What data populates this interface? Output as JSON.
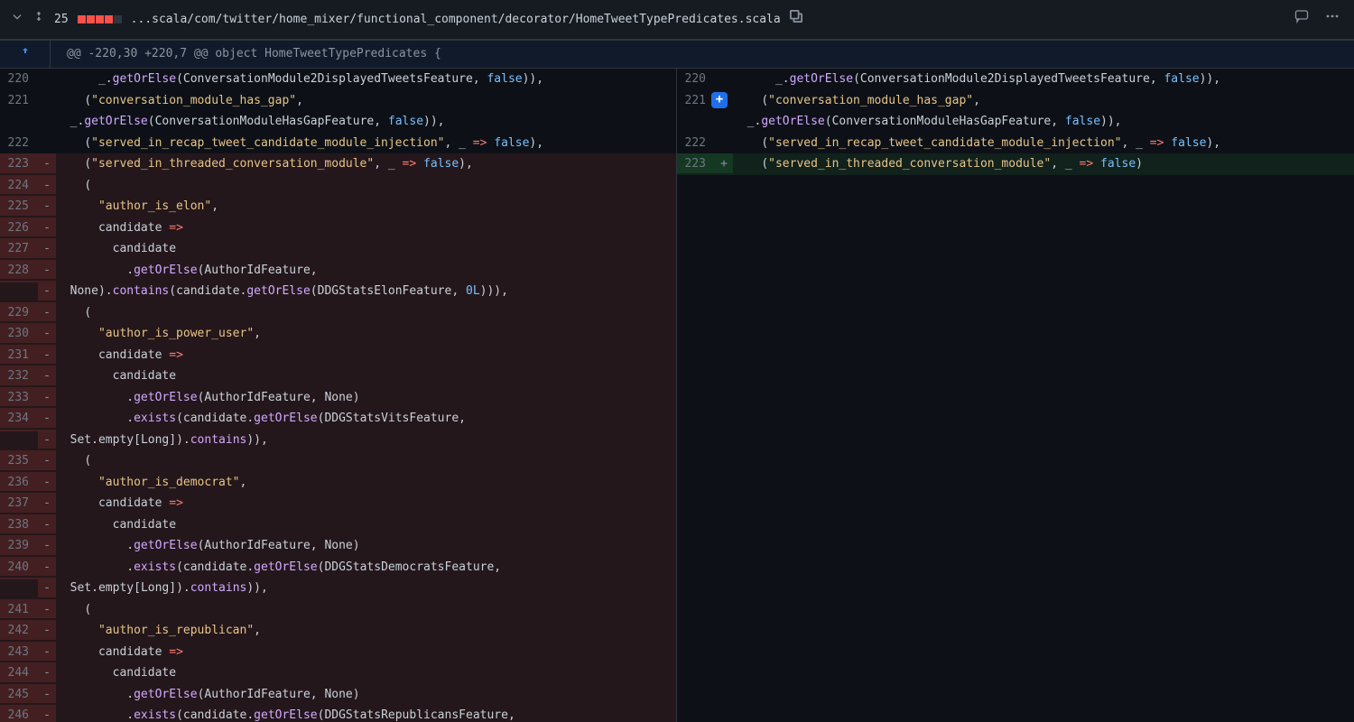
{
  "header": {
    "change_count": "25",
    "filepath": "...scala/com/twitter/home_mixer/functional_component/decorator/HomeTweetTypePredicates.scala",
    "diffstat_del": 4,
    "diffstat_neutral": 1
  },
  "hunk": {
    "text": "@@ -220,30 +220,7 @@ object HomeTweetTypePredicates {"
  },
  "left_lines": [
    {
      "n": "220",
      "t": "ctx",
      "tokens": [
        [
          "pl",
          "      _."
        ],
        [
          "fn",
          "getOrElse"
        ],
        [
          "pl",
          "("
        ],
        [
          "id",
          "ConversationModule2DisplayedTweetsFeature"
        ],
        [
          "pl",
          ", "
        ],
        [
          "false",
          "false"
        ],
        [
          "pl",
          ")),"
        ]
      ]
    },
    {
      "n": "221",
      "t": "ctx",
      "tokens": [
        [
          "pl",
          "    ("
        ],
        [
          "str",
          "\"conversation_module_has_gap\""
        ],
        [
          "pl",
          ","
        ]
      ]
    },
    {
      "n": "",
      "t": "ctx",
      "tokens": [
        [
          "pl",
          "  _."
        ],
        [
          "fn",
          "getOrElse"
        ],
        [
          "pl",
          "("
        ],
        [
          "id",
          "ConversationModuleHasGapFeature"
        ],
        [
          "pl",
          ", "
        ],
        [
          "false",
          "false"
        ],
        [
          "pl",
          ")),"
        ]
      ]
    },
    {
      "n": "222",
      "t": "ctx",
      "tokens": [
        [
          "pl",
          "    ("
        ],
        [
          "str",
          "\"served_in_recap_tweet_candidate_module_injection\""
        ],
        [
          "pl",
          ", _ "
        ],
        [
          "op",
          "=>"
        ],
        [
          "pl",
          " "
        ],
        [
          "false",
          "false"
        ],
        [
          "pl",
          "),"
        ]
      ]
    },
    {
      "n": "223",
      "t": "del",
      "tokens": [
        [
          "pl",
          "    ("
        ],
        [
          "str",
          "\"served_in_threaded_conversation_module\""
        ],
        [
          "pl",
          ", _ "
        ],
        [
          "op",
          "=>"
        ],
        [
          "pl",
          " "
        ],
        [
          "false",
          "false"
        ],
        [
          "pl",
          "),"
        ]
      ]
    },
    {
      "n": "224",
      "t": "del",
      "tokens": [
        [
          "pl",
          "    ("
        ]
      ]
    },
    {
      "n": "225",
      "t": "del",
      "tokens": [
        [
          "pl",
          "      "
        ],
        [
          "str",
          "\"author_is_elon\""
        ],
        [
          "pl",
          ","
        ]
      ]
    },
    {
      "n": "226",
      "t": "del",
      "tokens": [
        [
          "pl",
          "      candidate "
        ],
        [
          "op",
          "=>"
        ]
      ]
    },
    {
      "n": "227",
      "t": "del",
      "tokens": [
        [
          "pl",
          "        candidate"
        ]
      ]
    },
    {
      "n": "228",
      "t": "del",
      "tokens": [
        [
          "pl",
          "          ."
        ],
        [
          "fn",
          "getOrElse"
        ],
        [
          "pl",
          "("
        ],
        [
          "id",
          "AuthorIdFeature"
        ],
        [
          "pl",
          ","
        ]
      ]
    },
    {
      "n": "",
      "t": "del",
      "tokens": [
        [
          "pl",
          "  "
        ],
        [
          "id",
          "None"
        ],
        [
          "pl",
          ")."
        ],
        [
          "fn",
          "contains"
        ],
        [
          "pl",
          "(candidate."
        ],
        [
          "fn",
          "getOrElse"
        ],
        [
          "pl",
          "("
        ],
        [
          "id",
          "DDGStatsElonFeature"
        ],
        [
          "pl",
          ", "
        ],
        [
          "num",
          "0L"
        ],
        [
          "pl",
          "))),"
        ]
      ]
    },
    {
      "n": "229",
      "t": "del",
      "tokens": [
        [
          "pl",
          "    ("
        ]
      ]
    },
    {
      "n": "230",
      "t": "del",
      "tokens": [
        [
          "pl",
          "      "
        ],
        [
          "str",
          "\"author_is_power_user\""
        ],
        [
          "pl",
          ","
        ]
      ]
    },
    {
      "n": "231",
      "t": "del",
      "tokens": [
        [
          "pl",
          "      candidate "
        ],
        [
          "op",
          "=>"
        ]
      ]
    },
    {
      "n": "232",
      "t": "del",
      "tokens": [
        [
          "pl",
          "        candidate"
        ]
      ]
    },
    {
      "n": "233",
      "t": "del",
      "tokens": [
        [
          "pl",
          "          ."
        ],
        [
          "fn",
          "getOrElse"
        ],
        [
          "pl",
          "("
        ],
        [
          "id",
          "AuthorIdFeature"
        ],
        [
          "pl",
          ", "
        ],
        [
          "id",
          "None"
        ],
        [
          "pl",
          ")"
        ]
      ]
    },
    {
      "n": "234",
      "t": "del",
      "tokens": [
        [
          "pl",
          "          ."
        ],
        [
          "fn",
          "exists"
        ],
        [
          "pl",
          "(candidate."
        ],
        [
          "fn",
          "getOrElse"
        ],
        [
          "pl",
          "("
        ],
        [
          "id",
          "DDGStatsVitsFeature"
        ],
        [
          "pl",
          ","
        ]
      ]
    },
    {
      "n": "",
      "t": "del",
      "tokens": [
        [
          "pl",
          "  "
        ],
        [
          "id",
          "Set"
        ],
        [
          "pl",
          ".empty["
        ],
        [
          "id",
          "Long"
        ],
        [
          "pl",
          "])."
        ],
        [
          "fn",
          "contains"
        ],
        [
          "pl",
          ")),"
        ]
      ]
    },
    {
      "n": "235",
      "t": "del",
      "tokens": [
        [
          "pl",
          "    ("
        ]
      ]
    },
    {
      "n": "236",
      "t": "del",
      "tokens": [
        [
          "pl",
          "      "
        ],
        [
          "str",
          "\"author_is_democrat\""
        ],
        [
          "pl",
          ","
        ]
      ]
    },
    {
      "n": "237",
      "t": "del",
      "tokens": [
        [
          "pl",
          "      candidate "
        ],
        [
          "op",
          "=>"
        ]
      ]
    },
    {
      "n": "238",
      "t": "del",
      "tokens": [
        [
          "pl",
          "        candidate"
        ]
      ]
    },
    {
      "n": "239",
      "t": "del",
      "tokens": [
        [
          "pl",
          "          ."
        ],
        [
          "fn",
          "getOrElse"
        ],
        [
          "pl",
          "("
        ],
        [
          "id",
          "AuthorIdFeature"
        ],
        [
          "pl",
          ", "
        ],
        [
          "id",
          "None"
        ],
        [
          "pl",
          ")"
        ]
      ]
    },
    {
      "n": "240",
      "t": "del",
      "tokens": [
        [
          "pl",
          "          ."
        ],
        [
          "fn",
          "exists"
        ],
        [
          "pl",
          "(candidate."
        ],
        [
          "fn",
          "getOrElse"
        ],
        [
          "pl",
          "("
        ],
        [
          "id",
          "DDGStatsDemocratsFeature"
        ],
        [
          "pl",
          ","
        ]
      ]
    },
    {
      "n": "",
      "t": "del",
      "tokens": [
        [
          "pl",
          "  "
        ],
        [
          "id",
          "Set"
        ],
        [
          "pl",
          ".empty["
        ],
        [
          "id",
          "Long"
        ],
        [
          "pl",
          "])."
        ],
        [
          "fn",
          "contains"
        ],
        [
          "pl",
          ")),"
        ]
      ]
    },
    {
      "n": "241",
      "t": "del",
      "tokens": [
        [
          "pl",
          "    ("
        ]
      ]
    },
    {
      "n": "242",
      "t": "del",
      "tokens": [
        [
          "pl",
          "      "
        ],
        [
          "str",
          "\"author_is_republican\""
        ],
        [
          "pl",
          ","
        ]
      ]
    },
    {
      "n": "243",
      "t": "del",
      "tokens": [
        [
          "pl",
          "      candidate "
        ],
        [
          "op",
          "=>"
        ]
      ]
    },
    {
      "n": "244",
      "t": "del",
      "tokens": [
        [
          "pl",
          "        candidate"
        ]
      ]
    },
    {
      "n": "245",
      "t": "del",
      "tokens": [
        [
          "pl",
          "          ."
        ],
        [
          "fn",
          "getOrElse"
        ],
        [
          "pl",
          "("
        ],
        [
          "id",
          "AuthorIdFeature"
        ],
        [
          "pl",
          ", "
        ],
        [
          "id",
          "None"
        ],
        [
          "pl",
          ")"
        ]
      ]
    },
    {
      "n": "246",
      "t": "del",
      "tokens": [
        [
          "pl",
          "          ."
        ],
        [
          "fn",
          "exists"
        ],
        [
          "pl",
          "(candidate."
        ],
        [
          "fn",
          "getOrElse"
        ],
        [
          "pl",
          "("
        ],
        [
          "id",
          "DDGStatsRepublicansFeature"
        ],
        [
          "pl",
          ","
        ]
      ]
    }
  ],
  "right_lines": [
    {
      "n": "220",
      "t": "ctx",
      "tokens": [
        [
          "pl",
          "      _."
        ],
        [
          "fn",
          "getOrElse"
        ],
        [
          "pl",
          "("
        ],
        [
          "id",
          "ConversationModule2DisplayedTweetsFeature"
        ],
        [
          "pl",
          ", "
        ],
        [
          "false",
          "false"
        ],
        [
          "pl",
          ")),"
        ]
      ]
    },
    {
      "n": "221",
      "t": "ctx",
      "badge": true,
      "tokens": [
        [
          "pl",
          "    ("
        ],
        [
          "str",
          "\"conversation_module_has_gap\""
        ],
        [
          "pl",
          ","
        ]
      ]
    },
    {
      "n": "",
      "t": "ctx",
      "tokens": [
        [
          "pl",
          "  _."
        ],
        [
          "fn",
          "getOrElse"
        ],
        [
          "pl",
          "("
        ],
        [
          "id",
          "ConversationModuleHasGapFeature"
        ],
        [
          "pl",
          ", "
        ],
        [
          "false",
          "false"
        ],
        [
          "pl",
          ")),"
        ]
      ]
    },
    {
      "n": "222",
      "t": "ctx",
      "tokens": [
        [
          "pl",
          "    ("
        ],
        [
          "str",
          "\"served_in_recap_tweet_candidate_module_injection\""
        ],
        [
          "pl",
          ", _ "
        ],
        [
          "op",
          "=>"
        ],
        [
          "pl",
          " "
        ],
        [
          "false",
          "false"
        ],
        [
          "pl",
          "),"
        ]
      ]
    },
    {
      "n": "223",
      "t": "add",
      "tokens": [
        [
          "pl",
          "    ("
        ],
        [
          "str",
          "\"served_in_threaded_conversation_module\""
        ],
        [
          "pl",
          ", _ "
        ],
        [
          "op",
          "=>"
        ],
        [
          "pl",
          " "
        ],
        [
          "false",
          "false"
        ],
        [
          "pl",
          ")"
        ]
      ]
    }
  ]
}
